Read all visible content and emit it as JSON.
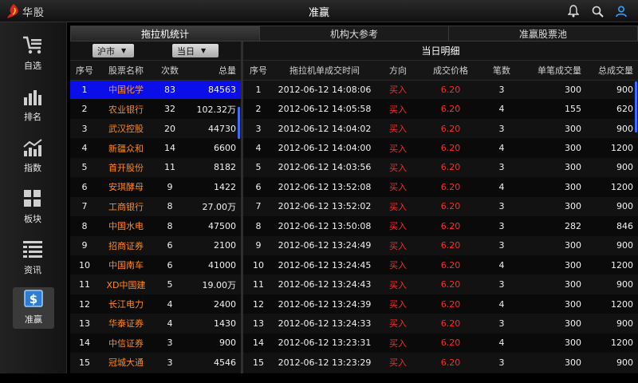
{
  "app": {
    "title": "准赢",
    "logo_text": "华股"
  },
  "sidebar": {
    "items": [
      {
        "label": "自选",
        "icon": "cart-list-icon"
      },
      {
        "label": "排名",
        "icon": "bar-chart-icon"
      },
      {
        "label": "指数",
        "icon": "trend-chart-icon"
      },
      {
        "label": "板块",
        "icon": "grid-icon"
      },
      {
        "label": "资讯",
        "icon": "news-list-icon"
      },
      {
        "label": "准赢",
        "icon": "dollar-icon",
        "active": true
      }
    ]
  },
  "tabs": [
    {
      "label": "拖拉机统计",
      "active": true
    },
    {
      "label": "机构大参考"
    },
    {
      "label": "准赢股票池"
    }
  ],
  "filters": {
    "market": "沪市",
    "period": "当日"
  },
  "left_table": {
    "columns": [
      "序号",
      "股票名称",
      "次数",
      "总量"
    ],
    "rows": [
      [
        "1",
        "中国化学",
        "83",
        "84563"
      ],
      [
        "2",
        "农业银行",
        "32",
        "102.32万"
      ],
      [
        "3",
        "武汉控股",
        "20",
        "44730"
      ],
      [
        "4",
        "新疆众和",
        "14",
        "6600"
      ],
      [
        "5",
        "首开股份",
        "11",
        "8182"
      ],
      [
        "6",
        "安琪酵母",
        "9",
        "1422"
      ],
      [
        "7",
        "工商银行",
        "8",
        "27.00万"
      ],
      [
        "8",
        "中国水电",
        "8",
        "47500"
      ],
      [
        "9",
        "招商证券",
        "6",
        "2100"
      ],
      [
        "10",
        "中国南车",
        "6",
        "41000"
      ],
      [
        "11",
        "XD中国建",
        "5",
        "19.00万"
      ],
      [
        "12",
        "长江电力",
        "4",
        "2400"
      ],
      [
        "13",
        "华泰证券",
        "4",
        "1430"
      ],
      [
        "14",
        "中信证券",
        "3",
        "900"
      ],
      [
        "15",
        "冠城大通",
        "3",
        "4546"
      ]
    ],
    "selected_index": 0
  },
  "detail": {
    "title": "当日明细",
    "columns": [
      "序号",
      "拖拉机单成交时间",
      "方向",
      "成交价格",
      "笔数",
      "单笔成交量",
      "总成交量"
    ],
    "rows": [
      [
        "1",
        "2012-06-12 14:08:06",
        "买入",
        "6.20",
        "3",
        "300",
        "900"
      ],
      [
        "2",
        "2012-06-12 14:05:58",
        "买入",
        "6.20",
        "4",
        "155",
        "620"
      ],
      [
        "3",
        "2012-06-12 14:04:02",
        "买入",
        "6.20",
        "3",
        "300",
        "900"
      ],
      [
        "4",
        "2012-06-12 14:04:00",
        "买入",
        "6.20",
        "4",
        "300",
        "1200"
      ],
      [
        "5",
        "2012-06-12 14:03:56",
        "买入",
        "6.20",
        "3",
        "300",
        "900"
      ],
      [
        "6",
        "2012-06-12 13:52:08",
        "买入",
        "6.20",
        "4",
        "300",
        "1200"
      ],
      [
        "7",
        "2012-06-12 13:52:02",
        "买入",
        "6.20",
        "3",
        "300",
        "900"
      ],
      [
        "8",
        "2012-06-12 13:50:08",
        "买入",
        "6.20",
        "3",
        "282",
        "846"
      ],
      [
        "9",
        "2012-06-12 13:24:49",
        "买入",
        "6.20",
        "3",
        "300",
        "900"
      ],
      [
        "10",
        "2012-06-12 13:24:45",
        "买入",
        "6.20",
        "4",
        "300",
        "1200"
      ],
      [
        "11",
        "2012-06-12 13:24:43",
        "买入",
        "6.20",
        "3",
        "300",
        "900"
      ],
      [
        "12",
        "2012-06-12 13:24:39",
        "买入",
        "6.20",
        "4",
        "300",
        "1200"
      ],
      [
        "13",
        "2012-06-12 13:24:33",
        "买入",
        "6.20",
        "3",
        "300",
        "900"
      ],
      [
        "14",
        "2012-06-12 13:23:31",
        "买入",
        "6.20",
        "4",
        "300",
        "1200"
      ],
      [
        "15",
        "2012-06-12 13:23:29",
        "买入",
        "6.20",
        "3",
        "300",
        "900"
      ]
    ]
  },
  "colors": {
    "selected_row": "#0a0ee8",
    "name_text": "#ff8a1c",
    "buy_text": "#ff2a2a",
    "scrollbar": "#3b6bff"
  }
}
